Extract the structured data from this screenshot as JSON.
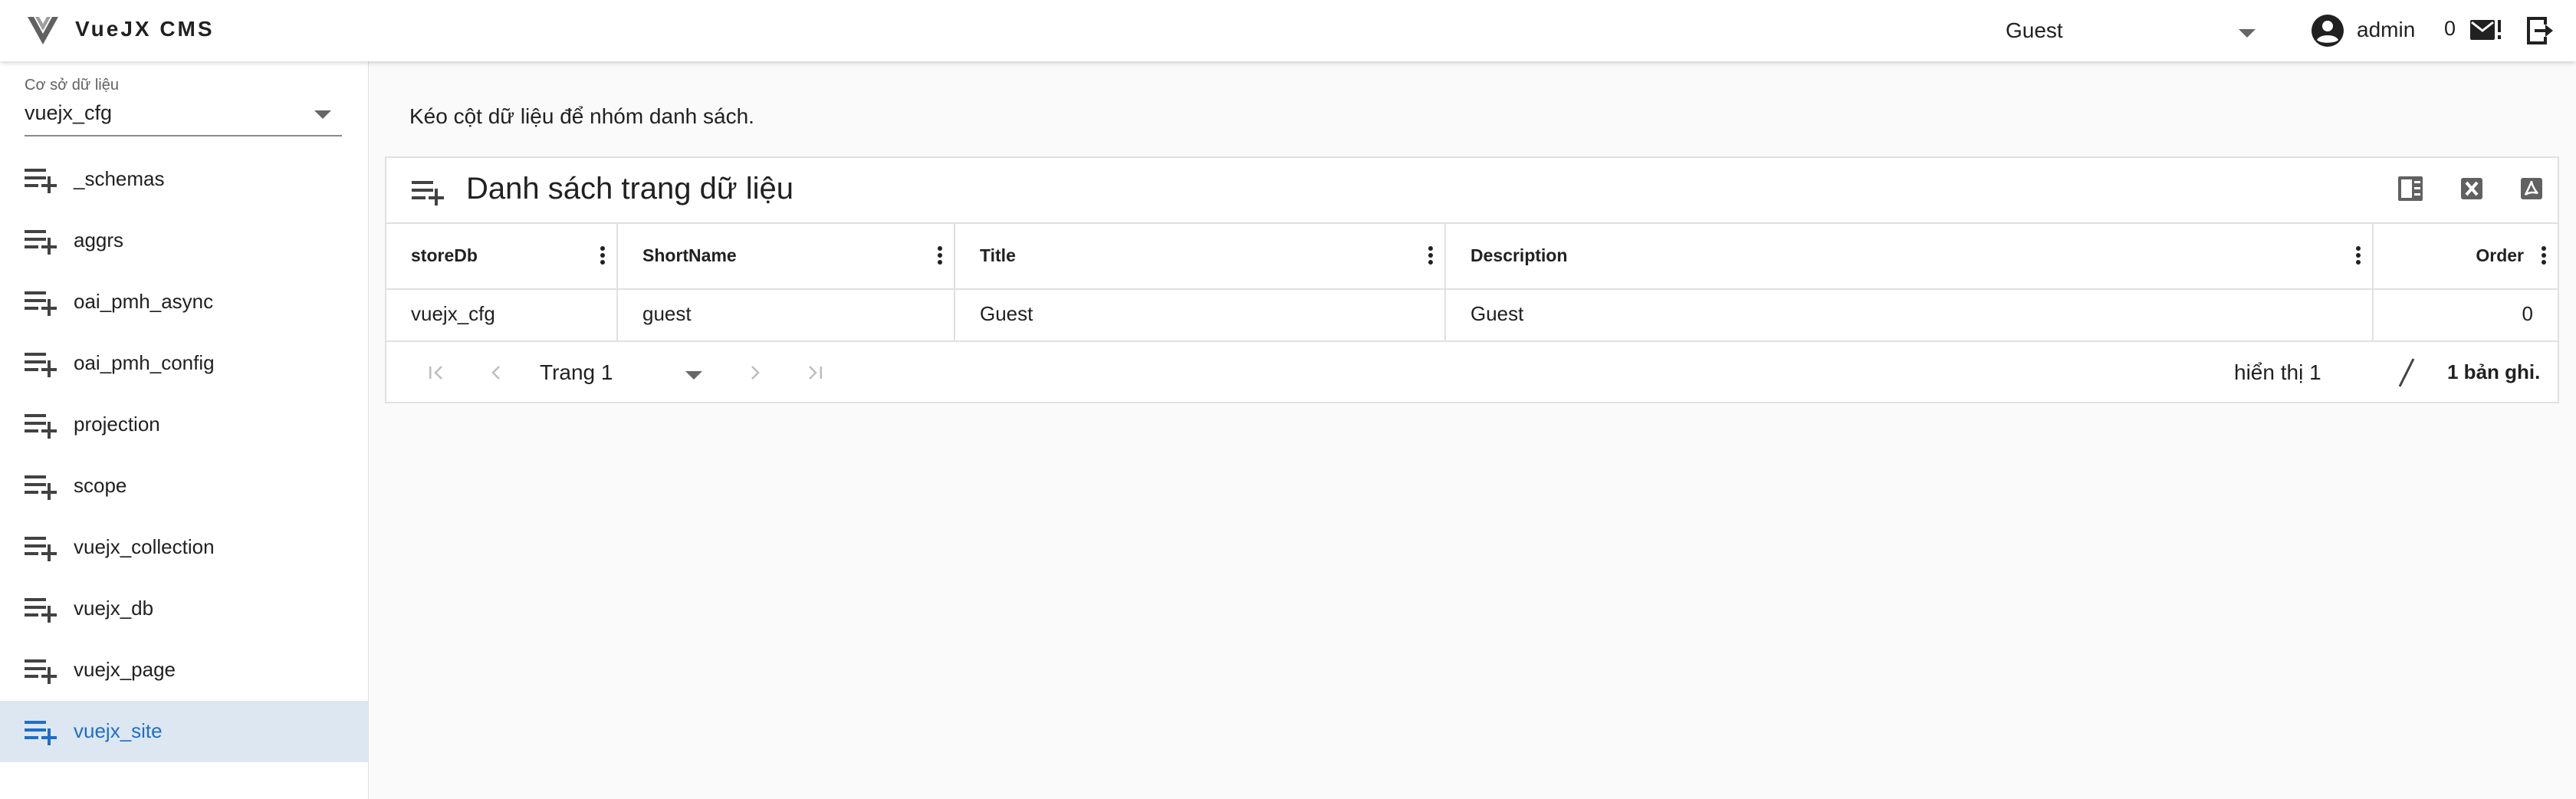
{
  "header": {
    "app_title": "VueJX CMS",
    "role_select": {
      "value": "Guest"
    },
    "username": "admin",
    "message_count": "0",
    "icons": [
      "vuejx-logo-icon",
      "account-circle-icon",
      "mail-alert-icon",
      "logout-icon"
    ]
  },
  "sidebar": {
    "db_select": {
      "label": "Cơ sở dữ liệu",
      "value": "vuejx_cfg"
    },
    "items": [
      {
        "label": "_schemas",
        "active": false
      },
      {
        "label": "aggrs",
        "active": false
      },
      {
        "label": "oai_pmh_async",
        "active": false
      },
      {
        "label": "oai_pmh_config",
        "active": false
      },
      {
        "label": "projection",
        "active": false
      },
      {
        "label": "scope",
        "active": false
      },
      {
        "label": "vuejx_collection",
        "active": false
      },
      {
        "label": "vuejx_db",
        "active": false
      },
      {
        "label": "vuejx_page",
        "active": false
      },
      {
        "label": "vuejx_site",
        "active": true
      }
    ],
    "item_icon": "playlist-add-icon",
    "active_color": "#1e6ec8",
    "active_background": "#dde7f1"
  },
  "main": {
    "group_hint": "Kéo cột dữ liệu để nhóm danh sách.",
    "panel": {
      "title": "Danh sách trang dữ liệu",
      "toolbar_icons": [
        "column-settings-icon",
        "excel-export-icon",
        "pdf-export-icon"
      ]
    },
    "table": {
      "columns": [
        "storeDb",
        "ShortName",
        "Title",
        "Description",
        "Order"
      ],
      "rows": [
        [
          "vuejx_cfg",
          "guest",
          "Guest",
          "Guest",
          "0"
        ]
      ]
    },
    "pager": {
      "page_select": "Trang 1",
      "showing": "hiển thị 1",
      "total": "1 bản ghi."
    }
  }
}
